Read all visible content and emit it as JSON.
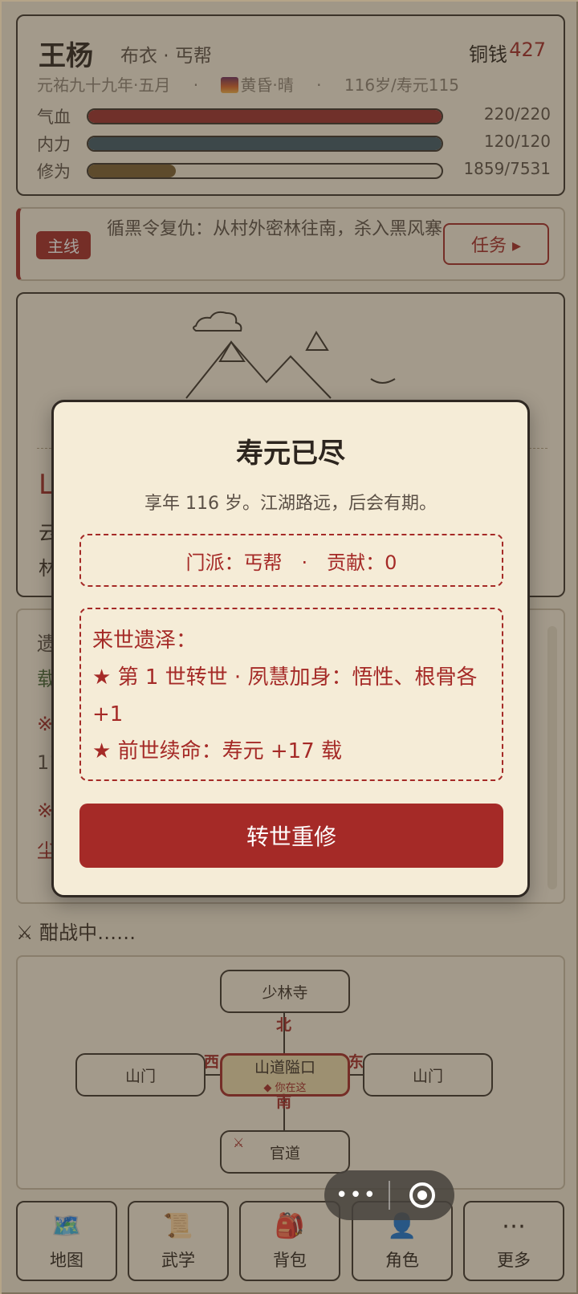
{
  "player": {
    "name": "王杨",
    "rank": "布衣 · 丐帮",
    "coin_label": "铜钱",
    "coin_value": "427",
    "date": "元祐九十九年·五月",
    "time_weather": "黄昏·晴",
    "age": "116岁/寿元115",
    "sep": "·"
  },
  "bars": [
    {
      "label": "气血",
      "value": "220/220",
      "fraction": 1.0,
      "color": "#9b2f2c"
    },
    {
      "label": "内力",
      "value": "120/120",
      "fraction": 1.0,
      "color": "#3e5a66"
    },
    {
      "label": "修为",
      "value": "1859/7531",
      "fraction": 0.247,
      "color": "#7a6030"
    }
  ],
  "quest": {
    "tag": "主线",
    "text": "循黑令复仇：从村外密林往南，杀入黑风寨",
    "button": "任务 ▸"
  },
  "scene": {
    "location_initial": "L",
    "line1": "云",
    "line2": "林"
  },
  "log": {
    "l1": "遗",
    "l2": "载",
    "l3": "※",
    "l4": "11",
    "l5": "※",
    "l6": "尘"
  },
  "battle": "⚔ 酣战中……",
  "map": {
    "north": "少林寺",
    "west": "山门",
    "center": "山道隘口",
    "center_note": "◆ 你在这",
    "east": "山门",
    "south": "官道",
    "dir_n": "北",
    "dir_s": "南",
    "dir_w": "西",
    "dir_e": "东",
    "south_mark": "⚔"
  },
  "nav": [
    {
      "icon": "🗺️",
      "label": "地图"
    },
    {
      "icon": "📜",
      "label": "武学"
    },
    {
      "icon": "🎒",
      "label": "背包"
    },
    {
      "icon": "👤",
      "label": "角色"
    },
    {
      "icon": "⋯",
      "label": "更多"
    }
  ],
  "modal": {
    "title": "寿元已尽",
    "subtitle": "享年 116 岁。江湖路远，后会有期。",
    "sect_info": "门派：丐帮　·　贡献：0",
    "legacy_title": "来世遗泽：",
    "legacy_1": "★ 第 1 世转世 · 夙慧加身：悟性、根骨各 +1",
    "legacy_2": "★ 前世续命：寿元 +17 载",
    "button": "转世重修"
  },
  "capsule": {
    "more": "•••"
  }
}
